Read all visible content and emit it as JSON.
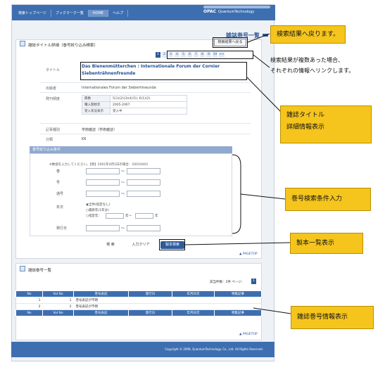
{
  "nav": {
    "items": [
      "検索トップページ",
      "ブックマーク一覧",
      "HOME",
      "ヘルプ"
    ],
    "logo": "OPAC",
    "logo_sub": "QuantumTechnology"
  },
  "header": {
    "title": "雑誌巻号一覧"
  },
  "detail": {
    "panel_title": "雑誌タイトル詳細（巻号絞り込み検索）",
    "back_button": "検索結果へ戻る",
    "pager": [
      "1",
      "2",
      "3",
      "4",
      "5",
      "6",
      "7",
      "8",
      "9",
      "10",
      ">>"
    ],
    "current_page": "1",
    "fields": [
      {
        "label": "タイトル",
        "value": ""
      },
      {
        "label": "出版者",
        "value": "Internationales Forum der Sieberhineunde"
      },
      {
        "label": "発刊頻度",
        "value": ""
      },
      {
        "label": "記事種別",
        "value": "学術雑誌（学術雑誌）"
      },
      {
        "label": "分類",
        "value": "K6"
      }
    ],
    "title_lines": [
      "Das Bienenmütterchen : Internationale Forum der Cornier",
      "Siebenträhnenfreunde"
    ],
    "sub_rows": [
      {
        "label": "冊数",
        "value": "5(1)(2)(3)(4)(5); 6(1)(2)"
      },
      {
        "label": "購入開始年",
        "value": "2005-2007"
      },
      {
        "label": "受入状況表示",
        "value": "受入中"
      }
    ]
  },
  "conditions": {
    "header": "巻号絞り込み条件",
    "hint": "※数値を入力してください。【例】2001年4月1日の場合：20010401",
    "fields": [
      "巻",
      "号",
      "通号",
      "年次",
      "発行日"
    ],
    "tilde": "～",
    "radio_options": [
      "全件(指定なし)",
      "最新年(1年分)",
      "指定年："
    ],
    "year_suffix": "年～",
    "year_suffix2": "年",
    "search_button": "検 索",
    "clear_button": "入力クリア",
    "bound_button": "製本検索"
  },
  "pagetop": "▲ PAGETOP",
  "list": {
    "title": "雑誌巻号一覧",
    "count_text": "該当件数：2件 ページ：",
    "count_page": "1",
    "columns": [
      "No",
      "Vol No",
      "巻号表記",
      "発行日",
      "年月日次",
      "特集記事"
    ],
    "rows": [
      [
        "1",
        "1",
        "巻号表記が不明",
        "",
        "",
        ""
      ],
      [
        "2",
        "2",
        "巻号表記が不明",
        "",
        "",
        ""
      ]
    ]
  },
  "footer": {
    "copyright": "Copyright © 2009, QuantumTechnology. Co., Ltd. All Rights Reserved."
  },
  "annotations": {
    "back": "検索結果へ戻ります。",
    "pager_note_1": "検索結果が複数あった場合、",
    "pager_note_2": "それぞれの情報へリンクします。",
    "title_note_1": "雑誌タイトル",
    "title_note_2": "詳細情報表示",
    "conditions": "巻号検索条件入力",
    "bound": "製本一覧表示",
    "list": "雑誌巻号情報表示"
  },
  "colors": {
    "accent": "#3d6fb0",
    "callout": "#f5c51d"
  }
}
